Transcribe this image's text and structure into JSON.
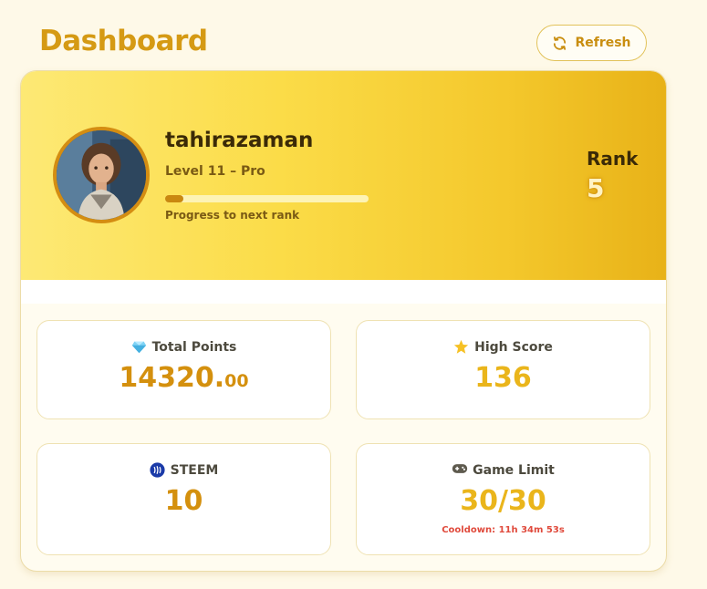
{
  "header": {
    "title": "Dashboard",
    "refresh_label": "Refresh"
  },
  "profile": {
    "username": "tahirazaman",
    "level": "Level 11 – Pro",
    "progress_label": "Progress to next rank",
    "progress_fraction": 0.09,
    "rank_label": "Rank",
    "rank_value": "5"
  },
  "stats": {
    "total_points": {
      "label": "Total Points",
      "value_int": "14320.",
      "value_dec": "00",
      "icon": "gem-icon"
    },
    "high_score": {
      "label": "High Score",
      "value": "136",
      "icon": "star-icon"
    },
    "steem": {
      "label": "STEEM",
      "value": "10",
      "icon": "steem-icon"
    },
    "game_limit": {
      "label": "Game Limit",
      "value": "30/30",
      "cooldown": "Cooldown: 11h 34m 53s",
      "icon": "gamepad-icon"
    }
  },
  "colors": {
    "accent": "#d59a14",
    "gold": "#eab51b",
    "cooldown": "#e04a3c"
  }
}
